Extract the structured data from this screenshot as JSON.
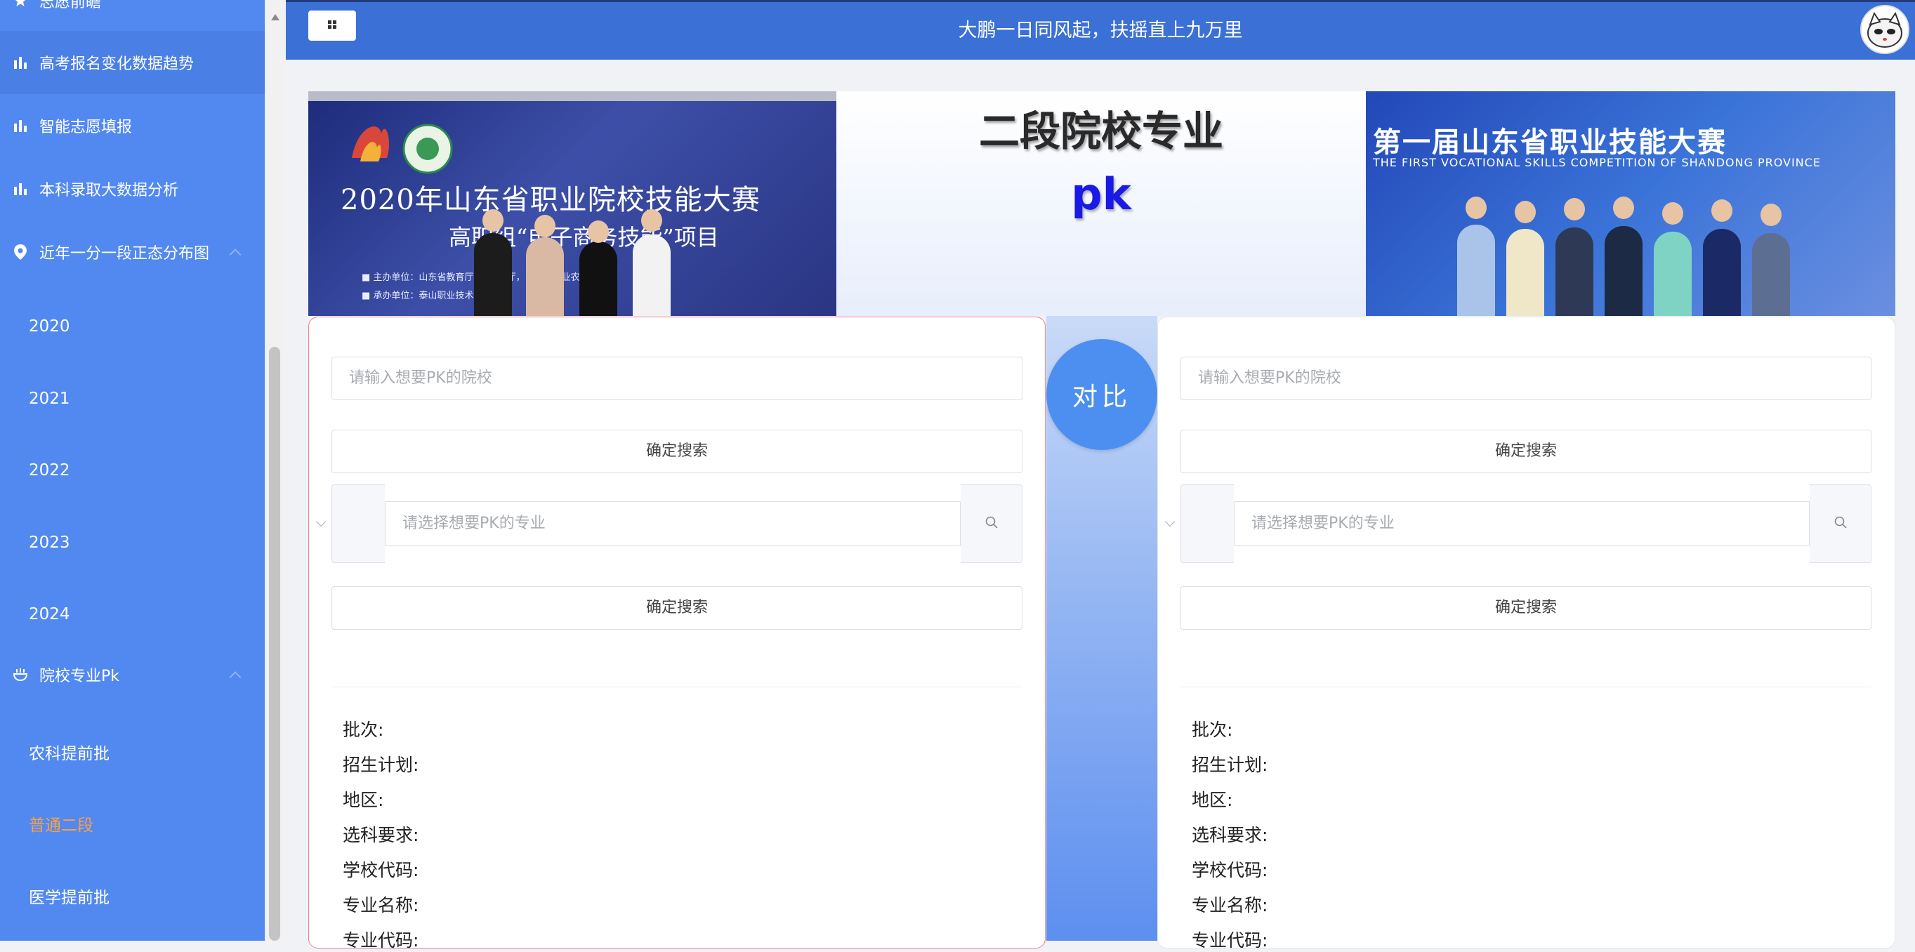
{
  "sidebar": {
    "items": [
      {
        "label": "志愿前瞻",
        "icon": "star-icon"
      },
      {
        "label": "高考报名变化数据趋势",
        "icon": "bar-chart-icon"
      },
      {
        "label": "智能志愿填报",
        "icon": "bar-chart-icon"
      },
      {
        "label": "本科录取大数据分析",
        "icon": "bar-chart-icon"
      },
      {
        "label": "近年一分一段正态分布图",
        "icon": "location-pin-icon"
      },
      {
        "label": "院校专业Pk",
        "icon": "bowl-icon"
      }
    ],
    "years": [
      "2020",
      "2021",
      "2022",
      "2023",
      "2024"
    ],
    "pk_sub": [
      "农科提前批",
      "普通二段",
      "医学提前批"
    ],
    "selected": "普通二段"
  },
  "header": {
    "title": "大鹏一日同风起，扶摇直上九万里",
    "menu_icon": "grid-icon"
  },
  "banner": {
    "title": "二段院校专业",
    "pk": "pk",
    "left_image": {
      "title": "2020年山东省职业院校技能大赛",
      "subtitle": "高职组“电子商务技能”项目",
      "lines": [
        "■ 主办单位：山东省教育厅 … 保障厅，山东省农业农村厅",
        "■ 承办单位：泰山职业技术学院"
      ]
    },
    "right_image": {
      "title": "第一届山东省职业技能大赛",
      "subtitle": "THE FIRST VOCATIONAL SKILLS COMPETITION OF SHANDONG PROVINCE"
    }
  },
  "compare_label": "对比",
  "left_card": {
    "school_placeholder": "请输入想要PK的院校",
    "search_label": "确定搜索",
    "major_placeholder": "请选择想要PK的专业",
    "search2_label": "确定搜索"
  },
  "right_card": {
    "school_placeholder": "请输入想要PK的院校",
    "search_label": "确定搜索",
    "major_placeholder": "请选择想要PK的专业",
    "search2_label": "确定搜索"
  },
  "info_fields": [
    "批次:",
    "招生计划:",
    "地区:",
    "选科要求:",
    "学校代码:",
    "专业名称:",
    "专业代码:"
  ],
  "colors": {
    "sidebar": "#5289f0",
    "header": "#3b70d6",
    "selected": "#f6a14a",
    "compare": "#4d8ff0",
    "pk": "#1a1ae6"
  }
}
